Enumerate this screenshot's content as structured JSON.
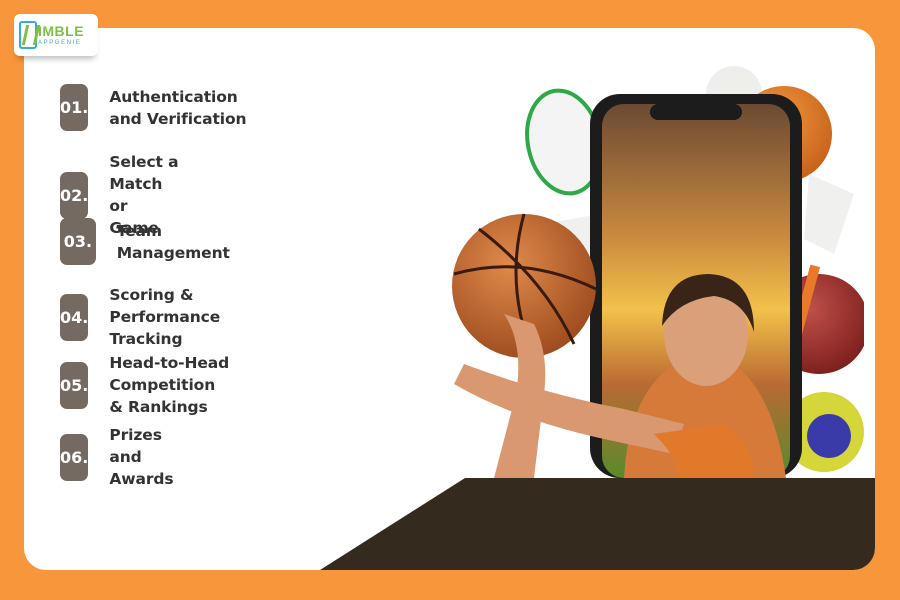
{
  "brand": {
    "name": "IMBLE",
    "initial": "N",
    "tagline": "APPGENIE"
  },
  "colors": {
    "background": "#f7963a",
    "card": "#ffffff",
    "badge": "#746a61",
    "text": "#333333",
    "band": "#342b1e"
  },
  "features": [
    {
      "number": "01.",
      "label": "Authentication and Verification"
    },
    {
      "number": "02.",
      "label": "Select a Match or Game"
    },
    {
      "number": "03.",
      "label": "Team Management"
    },
    {
      "number": "04.",
      "label": "Scoring & Performance Tracking"
    },
    {
      "number": "05.",
      "label": "Head-to-Head Competition & Rankings"
    },
    {
      "number": "06.",
      "label": "Prizes and Awards"
    }
  ],
  "hero": {
    "description": "Smartphone showing a female athlete holding a basketball, surrounded by sports balls, a badminton racket, shuttlecocks and a cricket bat"
  }
}
